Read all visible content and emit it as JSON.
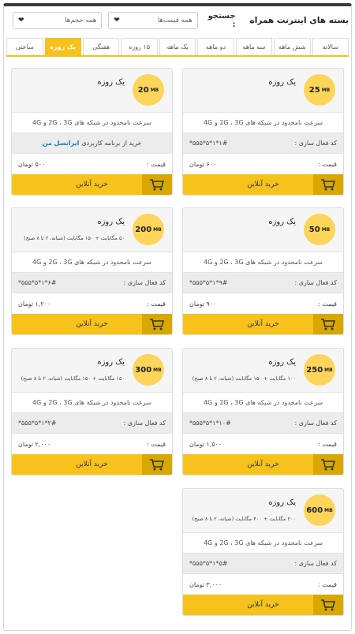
{
  "header": {
    "title": "بسته های اینترنت همراه",
    "search_label": "جستجو :",
    "price_select": "همه قیمت‌ها",
    "volume_select": "همه حجم‌ها"
  },
  "tabs": [
    "سالانه",
    "شش ماهه",
    "سه ماهه",
    "دو ماهه",
    "یک ماهه",
    "۱۵ روزه",
    "هفتگی",
    "یک روزه",
    "ساعتی"
  ],
  "active_tab": "یک روزه",
  "cards": [
    {
      "volume": "25",
      "unit": "MB",
      "name": "یک روزه",
      "desc": "",
      "speed": "سرعت نامحدود در شبکه های 2G ، 3G و 4G",
      "code_label": "کد فعال سازی :",
      "code": "*۵۵۵*۵*۱*۱#",
      "price_label": "قیمت :",
      "price": "۶۰۰ تومان",
      "buy": "خرید آنلاین"
    },
    {
      "volume": "20",
      "unit": "MB",
      "name": "یک روزه",
      "desc": "",
      "speed": "سرعت نامحدود در شبکه های 2G ، 3G و 4G",
      "app_text": "خرید از برنامه کاربردی",
      "app_name": "ایرانسل من",
      "price_label": "قیمت :",
      "price": "۵۰۰ تومان",
      "buy": "خرید آنلاین"
    },
    {
      "volume": "50",
      "unit": "MB",
      "name": "یک روزه",
      "desc": "",
      "speed": "سرعت نامحدود در شبکه های 2G ، 3G و 4G",
      "code_label": "کد فعال سازی :",
      "code": "*۵۵۵*۵*۱*۹#",
      "price_label": "قیمت :",
      "price": "۹۰۰ تومان",
      "buy": "خرید آنلاین"
    },
    {
      "volume": "200",
      "unit": "MB",
      "name": "یک روزه",
      "desc": "۵۰ مگابایت + ۱۵۰ مگابایت (شبانه، ۲ تا ۸ صبح)",
      "speed": "سرعت نامحدود در شبکه های 2G ، 3G و 4G",
      "code_label": "کد فعال سازی :",
      "code": "*۵۵۵*۵*۱*۶#",
      "price_label": "قیمت :",
      "price": "۱,۲۰۰ تومان",
      "buy": "خرید آنلاین"
    },
    {
      "volume": "250",
      "unit": "MB",
      "name": "یک روزه",
      "desc": "۱۰۰ مگابایت + ۱۵۰ مگابایت (شبانه، ۲ تا ۸ صبح)",
      "speed": "سرعت نامحدود در شبکه های 2G ، 3G و 4G",
      "code_label": "کد فعال سازی :",
      "code": "*۵۵۵*۵*۱*۱۰#",
      "price_label": "قیمت :",
      "price": "۱,۵۰۰ تومان",
      "buy": "خرید آنلاین"
    },
    {
      "volume": "300",
      "unit": "MB",
      "name": "یک روزه",
      "desc": "۱۵۰ مگابایت + ۱۵۰ مگابایت (شبانه، ۲ تا ۸ صبح)",
      "speed": "سرعت نامحدود در شبکه های 2G ، 3G و 4G",
      "code_label": "کد فعال سازی :",
      "code": "*۵۵۵*۵*۱*۲#",
      "price_label": "قیمت :",
      "price": "۲,۰۰۰ تومان",
      "buy": "خرید آنلاین"
    },
    {
      "volume": "600",
      "unit": "MB",
      "name": "یک روزه",
      "desc": "۲۰۰ مگابایت + ۴۰۰ مگابایت (شبانه، ۲ تا ۸ صبح)",
      "speed": "سرعت نامحدود در شبکه های 2G ، 3G و 4G",
      "code_label": "کد فعال سازی :",
      "code": "*۵۵۵*۵*۱*۵#",
      "price_label": "قیمت :",
      "price": "۳,۰۰۰ تومان",
      "buy": "خرید آنلاین"
    }
  ],
  "colors": {
    "accent": "#f7c21c",
    "badge": "#fcd55a",
    "link": "#1a7db8"
  }
}
